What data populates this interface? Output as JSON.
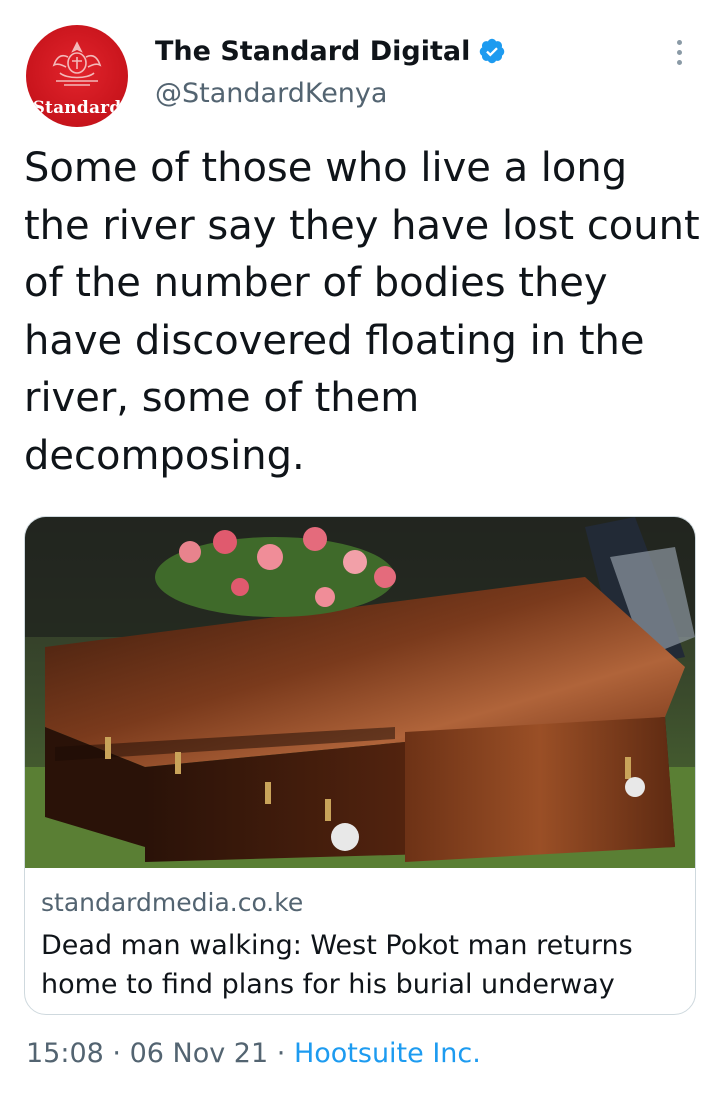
{
  "account": {
    "display_name": "The Standard Digital",
    "handle": "@StandardKenya",
    "avatar_label": "Standard",
    "verified": true,
    "avatar_color": "#d01a22",
    "verified_color": "#1d9bf0"
  },
  "tweet": {
    "text": "Some of those who live a long\nthe river say they have lost count\nof the number of bodies they\nhave discovered floating in the\nriver, some of them\ndecomposing."
  },
  "card": {
    "domain": "standardmedia.co.ke",
    "title": "Dead man walking: West Pokot man returns\nhome to find plans for his burial underway"
  },
  "meta": {
    "time": "15:08",
    "separator": "·",
    "date": "06 Nov 21",
    "source": "Hootsuite Inc."
  },
  "icons": {
    "more": "more-vertical-icon",
    "verified": "verified-badge-icon"
  }
}
